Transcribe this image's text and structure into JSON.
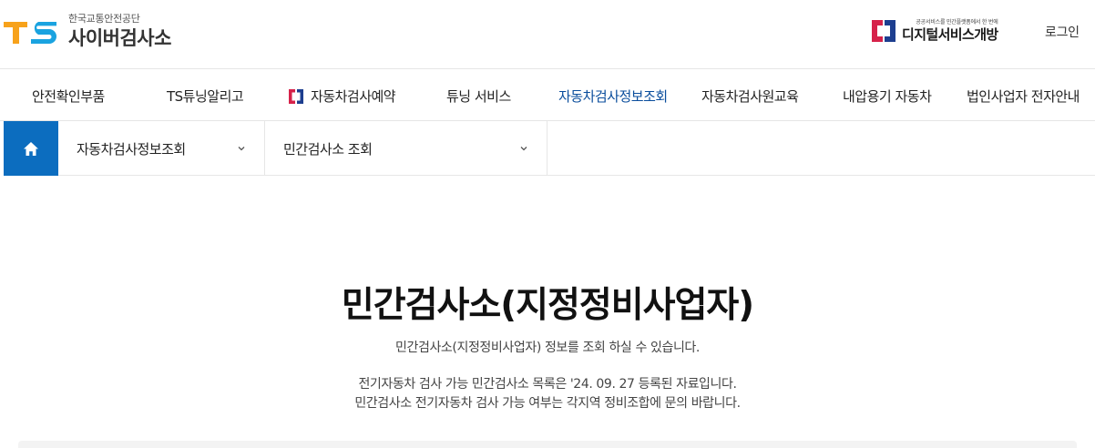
{
  "header": {
    "logo_org": "한국교통안전공단",
    "logo_site": "사이버검사소",
    "logo_mark_text": "TS",
    "digital_small": "공공서비스를 민간플랫폼에서 한 번에",
    "digital_big": "디지털서비스개방",
    "login_label": "로그인"
  },
  "nav": {
    "items": [
      {
        "label": "안전확인부품"
      },
      {
        "label": "TS튜닝알리고"
      },
      {
        "label": "자동차검사예약"
      },
      {
        "label": "튜닝 서비스"
      },
      {
        "label": "자동차검사정보조회",
        "active": true
      },
      {
        "label": "자동차검사원교육"
      },
      {
        "label": "내압용기 자동차"
      },
      {
        "label": "법인사업자 전자안내"
      }
    ]
  },
  "breadcrumb": {
    "home_icon": "home-icon",
    "level1": "자동차검사정보조회",
    "level2": "민간검사소 조회"
  },
  "main": {
    "title": "민간검사소(지정정비사업자)",
    "subtitle": "민간검사소(지정정비사업자) 정보를 조회 하실 수 있습니다.",
    "notice_line1": "전기자동차 검사 가능 민간검사소 목록은 '24. 09. 27 등록된 자료입니다.",
    "notice_line2": "민간검사소 전기자동차 검사 가능 여부는 각지역 정비조합에 문의 바랍니다."
  },
  "colors": {
    "brand_blue": "#0c6dbf",
    "active_nav": "#0a4d9c",
    "ts_orange": "#f7a21b",
    "ts_blue": "#1aa3e0",
    "digital_red": "#d6224a",
    "digital_navy": "#1d3e8f"
  }
}
